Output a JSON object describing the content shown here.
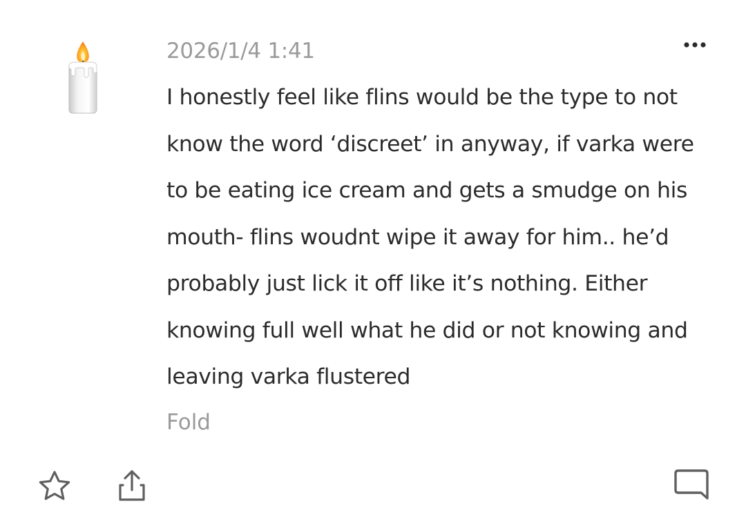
{
  "comment": {
    "avatar_icon": "candle-emoji-icon",
    "timestamp": "2026/1/4 1:41",
    "text": "I honestly feel like flins would be the type to not\nknow the word ‘discreet’ in anyway, if varka were\nto be eating ice cream and gets a smudge on his\nmouth- flins woudnt wipe it away for him.. he’d\nprobably just lick it off like it’s nothing. Either\nknowing full well what he did or not knowing and\nleaving varka flustered",
    "fold_label": "Fold",
    "more_icon": "more-options-icon"
  },
  "actions": {
    "favorite_icon": "star-icon",
    "share_icon": "share-icon",
    "comment_icon": "comment-icon"
  },
  "colors": {
    "text": "#2b2b2b",
    "muted": "#9a9a9a",
    "icon_stroke": "#5f5f5f"
  }
}
